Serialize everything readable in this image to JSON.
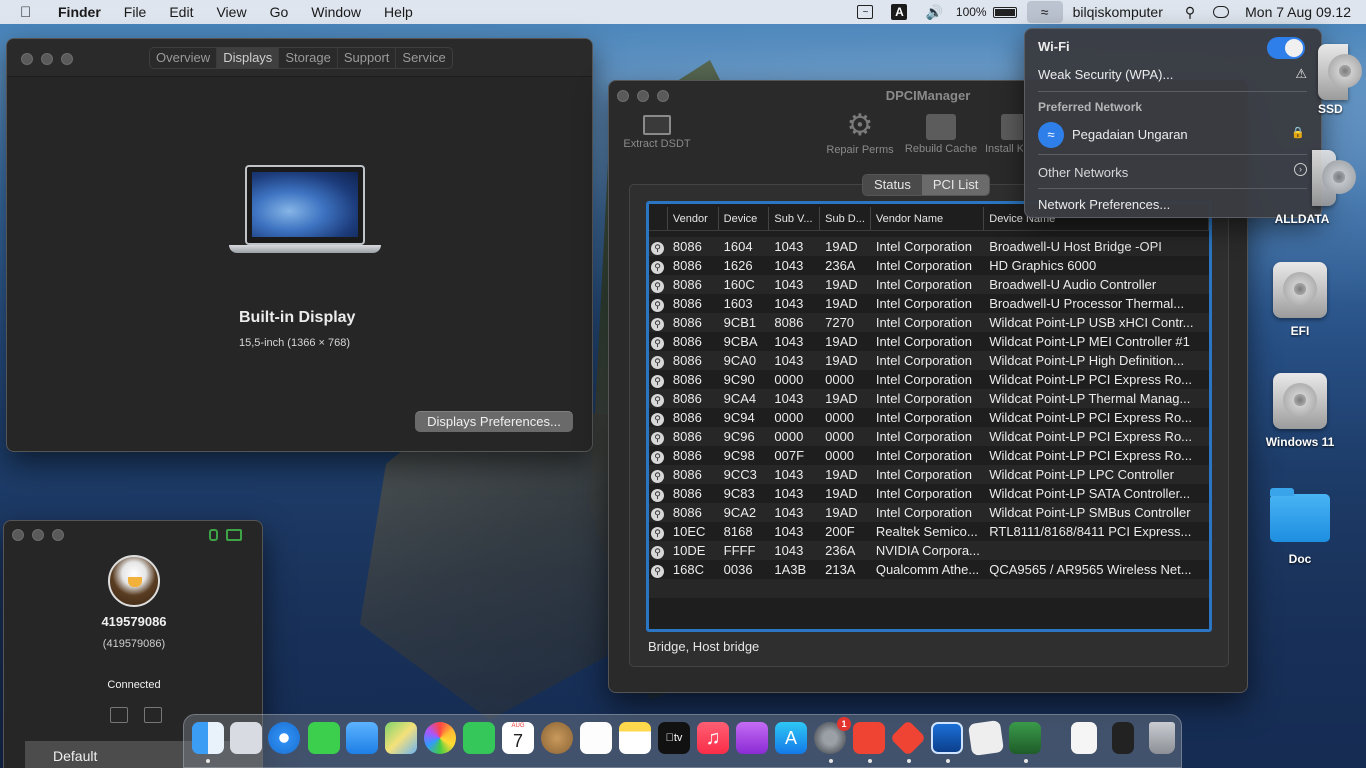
{
  "menubar": {
    "app": "Finder",
    "items": [
      "File",
      "Edit",
      "View",
      "Go",
      "Window",
      "Help"
    ],
    "battery": "100%",
    "user": "bilqiskomputer",
    "clock": "Mon 7 Aug  09.12",
    "icons": [
      "apple-icon",
      "activity-chart-icon",
      "input-source-icon",
      "volume-icon",
      "battery-icon",
      "wifi-icon",
      "spotlight-search-icon",
      "control-center-icon"
    ]
  },
  "about": {
    "tabs": [
      "Overview",
      "Displays",
      "Storage",
      "Support",
      "Service"
    ],
    "active_tab": "Displays",
    "display_name": "Built-in Display",
    "display_spec": "15,5-inch (1366 × 768)",
    "button": "Displays Preferences..."
  },
  "dpci": {
    "title": "DPCIManager",
    "toolbar": [
      "Extract DSDT",
      "Repair Perms",
      "Rebuild Cache",
      "Install Kext"
    ],
    "tabs": [
      "Status",
      "PCI List"
    ],
    "active_tab": "PCI List",
    "columns": [
      "Vendor",
      "Device",
      "Sub V...",
      "Sub D...",
      "Vendor Name",
      "Device Name"
    ],
    "rows": [
      [
        "8086",
        "1604",
        "1043",
        "19AD",
        "Intel Corporation",
        "Broadwell-U Host Bridge -OPI"
      ],
      [
        "8086",
        "1626",
        "1043",
        "236A",
        "Intel Corporation",
        "HD Graphics 6000"
      ],
      [
        "8086",
        "160C",
        "1043",
        "19AD",
        "Intel Corporation",
        "Broadwell-U Audio Controller"
      ],
      [
        "8086",
        "1603",
        "1043",
        "19AD",
        "Intel Corporation",
        "Broadwell-U Processor Thermal..."
      ],
      [
        "8086",
        "9CB1",
        "8086",
        "7270",
        "Intel Corporation",
        "Wildcat Point-LP USB xHCI Contr..."
      ],
      [
        "8086",
        "9CBA",
        "1043",
        "19AD",
        "Intel Corporation",
        "Wildcat Point-LP MEI Controller #1"
      ],
      [
        "8086",
        "9CA0",
        "1043",
        "19AD",
        "Intel Corporation",
        "Wildcat Point-LP High Definition..."
      ],
      [
        "8086",
        "9C90",
        "0000",
        "0000",
        "Intel Corporation",
        "Wildcat Point-LP PCI Express Ro..."
      ],
      [
        "8086",
        "9CA4",
        "1043",
        "19AD",
        "Intel Corporation",
        "Wildcat Point-LP Thermal Manag..."
      ],
      [
        "8086",
        "9C94",
        "0000",
        "0000",
        "Intel Corporation",
        "Wildcat Point-LP PCI Express Ro..."
      ],
      [
        "8086",
        "9C96",
        "0000",
        "0000",
        "Intel Corporation",
        "Wildcat Point-LP PCI Express Ro..."
      ],
      [
        "8086",
        "9C98",
        "007F",
        "0000",
        "Intel Corporation",
        "Wildcat Point-LP PCI Express Ro..."
      ],
      [
        "8086",
        "9CC3",
        "1043",
        "19AD",
        "Intel Corporation",
        "Wildcat Point-LP LPC Controller"
      ],
      [
        "8086",
        "9C83",
        "1043",
        "19AD",
        "Intel Corporation",
        "Wildcat Point-LP SATA Controller..."
      ],
      [
        "8086",
        "9CA2",
        "1043",
        "19AD",
        "Intel Corporation",
        "Wildcat Point-LP SMBus Controller"
      ],
      [
        "10EC",
        "8168",
        "1043",
        "200F",
        "Realtek Semico...",
        "RTL8111/8168/8411 PCI Express..."
      ],
      [
        "10DE",
        "FFFF",
        "1043",
        "236A",
        "NVIDIA Corpora...",
        ""
      ],
      [
        "168C",
        "0036",
        "1A3B",
        "213A",
        "Qualcomm Athe...",
        "QCA9565 / AR9565 Wireless Net..."
      ]
    ],
    "status": "Bridge, Host bridge"
  },
  "wifi_menu": {
    "title": "Wi-Fi",
    "enabled": true,
    "warning": "Weak Security (WPA)...",
    "preferred_label": "Preferred Network",
    "preferred_network": "Pegadaian Ungaran",
    "other_networks": "Other Networks",
    "network_prefs": "Network Preferences..."
  },
  "tv": {
    "id": "419579086",
    "id_paren": "(419579086)",
    "status": "Connected",
    "profile": "Default"
  },
  "desktop": {
    "icons": [
      {
        "label": "SSD",
        "icon": "disk-icon"
      },
      {
        "label": "ALLDATA",
        "icon": "disk-icon"
      },
      {
        "label": "EFI",
        "icon": "disk-icon"
      },
      {
        "label": "Windows 11",
        "icon": "disk-icon"
      },
      {
        "label": "Doc",
        "icon": "folder-icon"
      }
    ]
  },
  "dock": {
    "calendar_month": "AUG",
    "calendar_day": "7",
    "badge": "1",
    "apps": [
      "finder",
      "launchpad",
      "safari",
      "messages",
      "mail",
      "maps",
      "photos",
      "facetime",
      "calendar",
      "contacts",
      "reminders",
      "notes",
      "tv",
      "music",
      "podcasts",
      "app-store",
      "system-preferences",
      "anydesk",
      "anydesk-2",
      "intel-power-gadget",
      "script-editor",
      "system-information",
      "document",
      "terminal-app",
      "trash"
    ]
  }
}
